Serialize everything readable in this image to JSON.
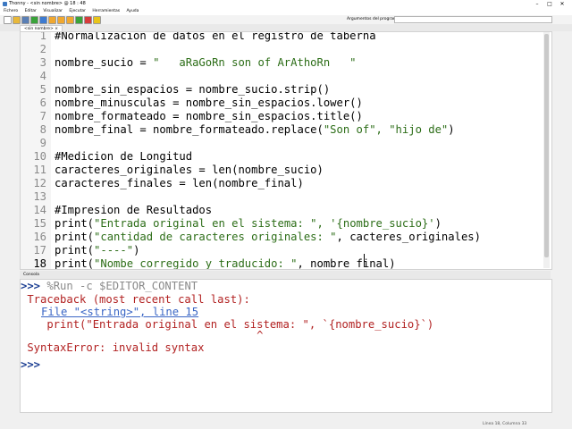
{
  "window": {
    "title": "Thonny - <sin nombre> @ 18 : 48",
    "controls": [
      "–",
      "□",
      "✕"
    ]
  },
  "menu": [
    "Fichero",
    "Editar",
    "Visualizar",
    "Ejecutar",
    "Herramientas",
    "Ayuda"
  ],
  "toolbar": {
    "args_label": "Argumentos del programa:",
    "args_value": "",
    "buttons": [
      {
        "icon": "new-file-icon",
        "color": "#ffffff"
      },
      {
        "icon": "open-folder-icon",
        "color": "#e8b83a"
      },
      {
        "icon": "save-icon",
        "color": "#5a7fb5"
      },
      {
        "icon": "run-icon",
        "color": "#3aa33a"
      },
      {
        "icon": "debug-icon",
        "color": "#3d7bd1"
      },
      {
        "icon": "step-over-icon",
        "color": "#f0a830"
      },
      {
        "icon": "step-into-icon",
        "color": "#f0a830"
      },
      {
        "icon": "step-out-icon",
        "color": "#f0a830"
      },
      {
        "icon": "resume-icon",
        "color": "#3aa33a"
      },
      {
        "icon": "stop-icon",
        "color": "#d63c3c"
      },
      {
        "icon": "flag-icon",
        "color": "#e8c41a"
      }
    ]
  },
  "editor_tab": "<sin nombre> ×",
  "editor": {
    "lines": [
      {
        "n": "1",
        "text": "#Normalizacion de datos en el registro de taberna",
        "kind": "cmt"
      },
      {
        "n": "2",
        "text": "",
        "kind": "plain"
      },
      {
        "n": "3",
        "pre": "nombre_sucio = ",
        "str": "\"   aRaGoRn son of ArAthoRn   \"",
        "post": "",
        "kind": "mixed"
      },
      {
        "n": "4",
        "text": "",
        "kind": "plain"
      },
      {
        "n": "5",
        "text": "nombre_sin_espacios = nombre_sucio.strip()",
        "kind": "plain"
      },
      {
        "n": "6",
        "text": "nombre_minusculas = nombre_sin_espacios.lower()",
        "kind": "plain"
      },
      {
        "n": "7",
        "text": "nombre_formateado = nombre_sin_espacios.title()",
        "kind": "plain"
      },
      {
        "n": "8",
        "pre": "nombre_final = nombre_formateado.replace(",
        "str": "\"Son of\", \"hijo de\"",
        "post": ")",
        "kind": "mixed"
      },
      {
        "n": "9",
        "text": "",
        "kind": "plain"
      },
      {
        "n": "10",
        "text": "#Medicion de Longitud",
        "kind": "cmt"
      },
      {
        "n": "11",
        "text": "caracteres_originales = len(nombre_sucio)",
        "kind": "plain"
      },
      {
        "n": "12",
        "text": "caracteres_finales = len(nombre_final)",
        "kind": "plain"
      },
      {
        "n": "13",
        "text": "",
        "kind": "plain"
      },
      {
        "n": "14",
        "text": "#Impresion de Resultados",
        "kind": "cmt"
      },
      {
        "n": "15",
        "pre": "print(",
        "str": "\"Entrada original en el sistema: \", '{nombre_sucio}'",
        "post": ")",
        "kind": "mixed"
      },
      {
        "n": "16",
        "pre": "print(",
        "str": "\"cantidad de caracteres originales: \"",
        "post": ", cacteres_originales)",
        "kind": "mixed"
      },
      {
        "n": "17",
        "pre": "print(",
        "str": "\"----\"",
        "post": ")",
        "kind": "mixed"
      },
      {
        "n": "18",
        "pre": "print(",
        "str": "\"Nombe corregido y traducido: \"",
        "post": ", nombre final)",
        "kind": "mixed"
      }
    ]
  },
  "console_title": "Consola",
  "console": {
    "prompt": ">>>",
    "command": " %Run -c $EDITOR_CONTENT",
    "traceback": " Traceback (most recent call last):",
    "file_ref": "File \"<string>\", line 15",
    "source_line": "    print(\"Entrada original en el sistema: \", `{nombre_sucio}`)",
    "caret": "                                    ^",
    "error": " SyntaxError: invalid syntax",
    "final_prompt": ">>>"
  },
  "statusbar": {
    "position": "Línea 18, Columna 33"
  }
}
